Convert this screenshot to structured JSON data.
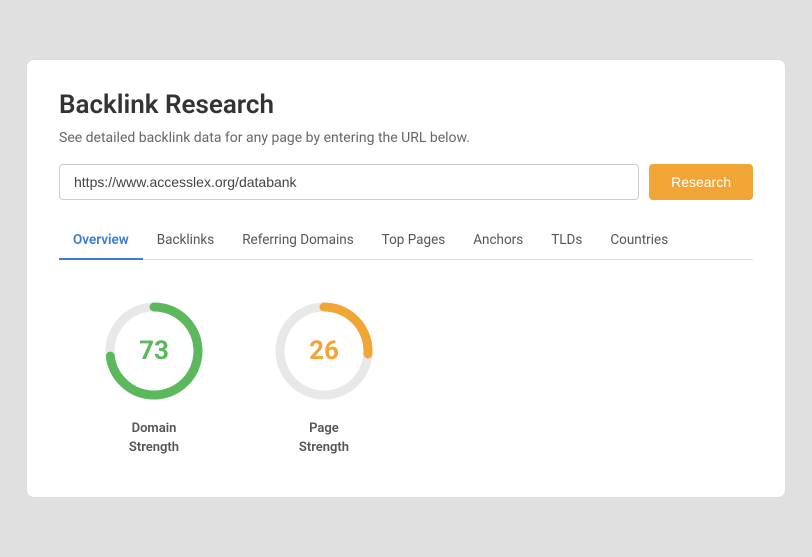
{
  "page": {
    "title": "Backlink Research",
    "subtitle": "See detailed backlink data for any page by entering the URL below."
  },
  "search": {
    "placeholder": "https://www.accesslex.org/databank",
    "value": "https://www.accesslex.org/databank",
    "button_label": "Research"
  },
  "tabs": [
    {
      "id": "overview",
      "label": "Overview",
      "active": true
    },
    {
      "id": "backlinks",
      "label": "Backlinks",
      "active": false
    },
    {
      "id": "referring-domains",
      "label": "Referring Domains",
      "active": false
    },
    {
      "id": "top-pages",
      "label": "Top Pages",
      "active": false
    },
    {
      "id": "anchors",
      "label": "Anchors",
      "active": false
    },
    {
      "id": "tlds",
      "label": "TLDs",
      "active": false
    },
    {
      "id": "countries",
      "label": "Countries",
      "active": false
    }
  ],
  "metrics": [
    {
      "id": "domain-strength",
      "value": 73,
      "label": "Domain\nStrength",
      "color": "#5cb85c",
      "bg_color": "#e8e8e8",
      "percent": 73
    },
    {
      "id": "page-strength",
      "value": 26,
      "label": "Page\nStrength",
      "color": "#f0a535",
      "bg_color": "#e8e8e8",
      "percent": 26
    }
  ],
  "colors": {
    "active_tab": "#3a7bd5",
    "green": "#5cb85c",
    "orange": "#f0a535",
    "button_bg": "#f0a535"
  }
}
